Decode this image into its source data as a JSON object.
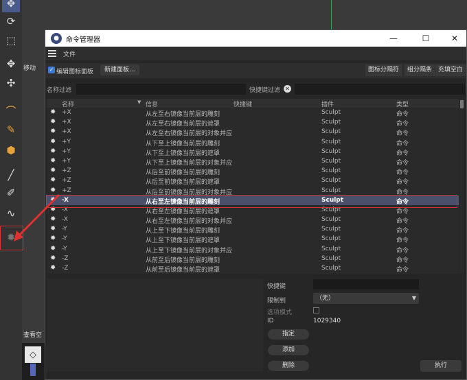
{
  "app": {
    "move_label": "移动",
    "view_layer_label": "查看空"
  },
  "dialog": {
    "title": "命令管理器",
    "menu": {
      "file": "文件"
    },
    "toolbar": {
      "edit_icon_panel": "编辑图标面板",
      "new_panel": "新建面板...",
      "icon_separator": "图标分隔符",
      "group_separator": "组分隔条",
      "fill_blank": "充填空白"
    },
    "filters": {
      "name_filter_label": "名称过滤",
      "shortcut_filter_label": "快捷键过滤"
    },
    "table": {
      "columns": {
        "name": "名称",
        "info": "信息",
        "shortcut": "快捷键",
        "plugin": "插件",
        "type": "类型"
      },
      "rows": [
        {
          "name": "+X",
          "info": "从左至右镜像当前层的雕刻",
          "shortcut": "",
          "plugin": "Sculpt",
          "type": "命令"
        },
        {
          "name": "+X",
          "info": "从左至右镜像当前层的遮罩",
          "shortcut": "",
          "plugin": "Sculpt",
          "type": "命令"
        },
        {
          "name": "+X",
          "info": "从左至右镜像当前层的对象并应",
          "shortcut": "",
          "plugin": "Sculpt",
          "type": "命令"
        },
        {
          "name": "+Y",
          "info": "从下至上镜像当前层的雕刻",
          "shortcut": "",
          "plugin": "Sculpt",
          "type": "命令"
        },
        {
          "name": "+Y",
          "info": "从下至上镜像当前层的遮罩",
          "shortcut": "",
          "plugin": "Sculpt",
          "type": "命令"
        },
        {
          "name": "+Y",
          "info": "从下至上镜像当前层的对象并应",
          "shortcut": "",
          "plugin": "Sculpt",
          "type": "命令"
        },
        {
          "name": "+Z",
          "info": "从后至前镜像当前层的雕刻",
          "shortcut": "",
          "plugin": "Sculpt",
          "type": "命令"
        },
        {
          "name": "+Z",
          "info": "从后至前镜像当前层的遮罩",
          "shortcut": "",
          "plugin": "Sculpt",
          "type": "命令"
        },
        {
          "name": "+Z",
          "info": "从后至前镜像当前层的对象并应",
          "shortcut": "",
          "plugin": "Sculpt",
          "type": "命令"
        },
        {
          "name": "-X",
          "info": "从右至左镜像当前层的雕刻",
          "shortcut": "",
          "plugin": "Sculpt",
          "type": "命令",
          "selected": true
        },
        {
          "name": "-X",
          "info": "从右至左镜像当前层的遮罩",
          "shortcut": "",
          "plugin": "Sculpt",
          "type": "命令"
        },
        {
          "name": "-X",
          "info": "从右至左镜像当前层的对象并应",
          "shortcut": "",
          "plugin": "Sculpt",
          "type": "命令"
        },
        {
          "name": "-Y",
          "info": "从上至下镜像当前层的雕刻",
          "shortcut": "",
          "plugin": "Sculpt",
          "type": "命令"
        },
        {
          "name": "-Y",
          "info": "从上至下镜像当前层的遮罩",
          "shortcut": "",
          "plugin": "Sculpt",
          "type": "命令"
        },
        {
          "name": "-Y",
          "info": "从上至下镜像当前层的对象并应",
          "shortcut": "",
          "plugin": "Sculpt",
          "type": "命令"
        },
        {
          "name": "-Z",
          "info": "从前至后镜像当前层的雕刻",
          "shortcut": "",
          "plugin": "Sculpt",
          "type": "命令"
        },
        {
          "name": "-Z",
          "info": "从前至后镜像当前层的遮罩",
          "shortcut": "",
          "plugin": "Sculpt",
          "type": "命令"
        }
      ]
    },
    "details": {
      "shortcut_label": "快捷键",
      "limit_to_label": "限制到",
      "limit_to_value": "（无）",
      "option_mode_label": "选项模式",
      "id_label": "ID",
      "id_value": "1029340",
      "assign_button": "指定",
      "add_button": "添加",
      "delete_button": "删除",
      "execute_button": "执行"
    }
  },
  "colors": {
    "highlight": "#e03030",
    "selected_row": "#4a4f6a",
    "accent": "#3a7bd5"
  }
}
